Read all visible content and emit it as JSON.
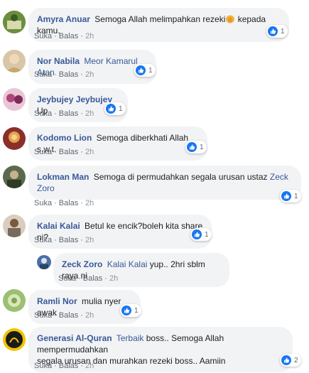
{
  "comments": [
    {
      "author": "Amyra Anuar",
      "text_before": "Semoga Allah melimpahkan rezeki",
      "emoji": "folded-hands-emoji",
      "text_after": " kepada kamu.",
      "actions": {
        "like": "Suka",
        "reply": "Balas",
        "time": "2h"
      },
      "reactions": "1",
      "avatar_color": "#6b8f3c"
    },
    {
      "author": "Nor Nabila",
      "tag": "Meor Kamarul Atan",
      "actions": {
        "like": "Suka",
        "reply": "Balas",
        "time": "2h"
      },
      "reactions": "1",
      "avatar_color": "#c9a66b"
    },
    {
      "author": "Jeybujey Jeybujey",
      "text": "Up",
      "actions": {
        "like": "Suka",
        "reply": "Balas",
        "time": "2h"
      },
      "reactions": "1",
      "avatar_color": "#b0457a"
    },
    {
      "author": "Kodomo Lion",
      "text": "Semoga diberkhati Allah s.w.t.",
      "actions": {
        "like": "Suka",
        "reply": "Balas",
        "time": "2h"
      },
      "reactions": "1",
      "avatar_color": "#8a2f2a"
    },
    {
      "author": "Lokman Man",
      "text": "Semoga di permudahkan segala urusan ustaz",
      "tag_line1": "Zeck",
      "tag_line2": "Zoro",
      "actions": {
        "like": "Suka",
        "reply": "Balas",
        "time": "2h"
      },
      "reactions": "1",
      "avatar_color": "#5b6a4d"
    },
    {
      "author": "Kalai Kalai",
      "text": "Betul ke encik?boleh kita share ni?",
      "actions": {
        "like": "Suka",
        "reply": "Balas",
        "time": "2h"
      },
      "reactions": "1",
      "avatar_color": "#7a6a5d"
    },
    {
      "author": "Zeck Zoro",
      "tag": "Kalai Kalai",
      "text": "yup.. 2hri sblm raya ni",
      "actions": {
        "like": "Suka",
        "reply": "Balas",
        "time": "2h"
      },
      "avatar_color": "#4a6fa5"
    },
    {
      "author": "Ramli Nor",
      "text": "mulia nyer awak",
      "actions": {
        "like": "Suka",
        "reply": "Balas",
        "time": "2h"
      },
      "reactions": "1",
      "avatar_color": "#7fa35a"
    },
    {
      "author": "Generasi Al-Quran",
      "tag": "Terbaik",
      "text_line1": "boss.. Semoga Allah mempermudahkan",
      "text_line2": "segala urusan dan murahkan rezeki boss.. Aamiin",
      "actions": {
        "like": "Suka",
        "reply": "Balas",
        "time": "2h"
      },
      "reactions": "2",
      "avatar_color": "#1a1a1a"
    }
  ],
  "colors": {
    "link": "#385898",
    "bubble": "#f2f3f5",
    "like_blue": "#1877f2",
    "meta": "#606770"
  }
}
